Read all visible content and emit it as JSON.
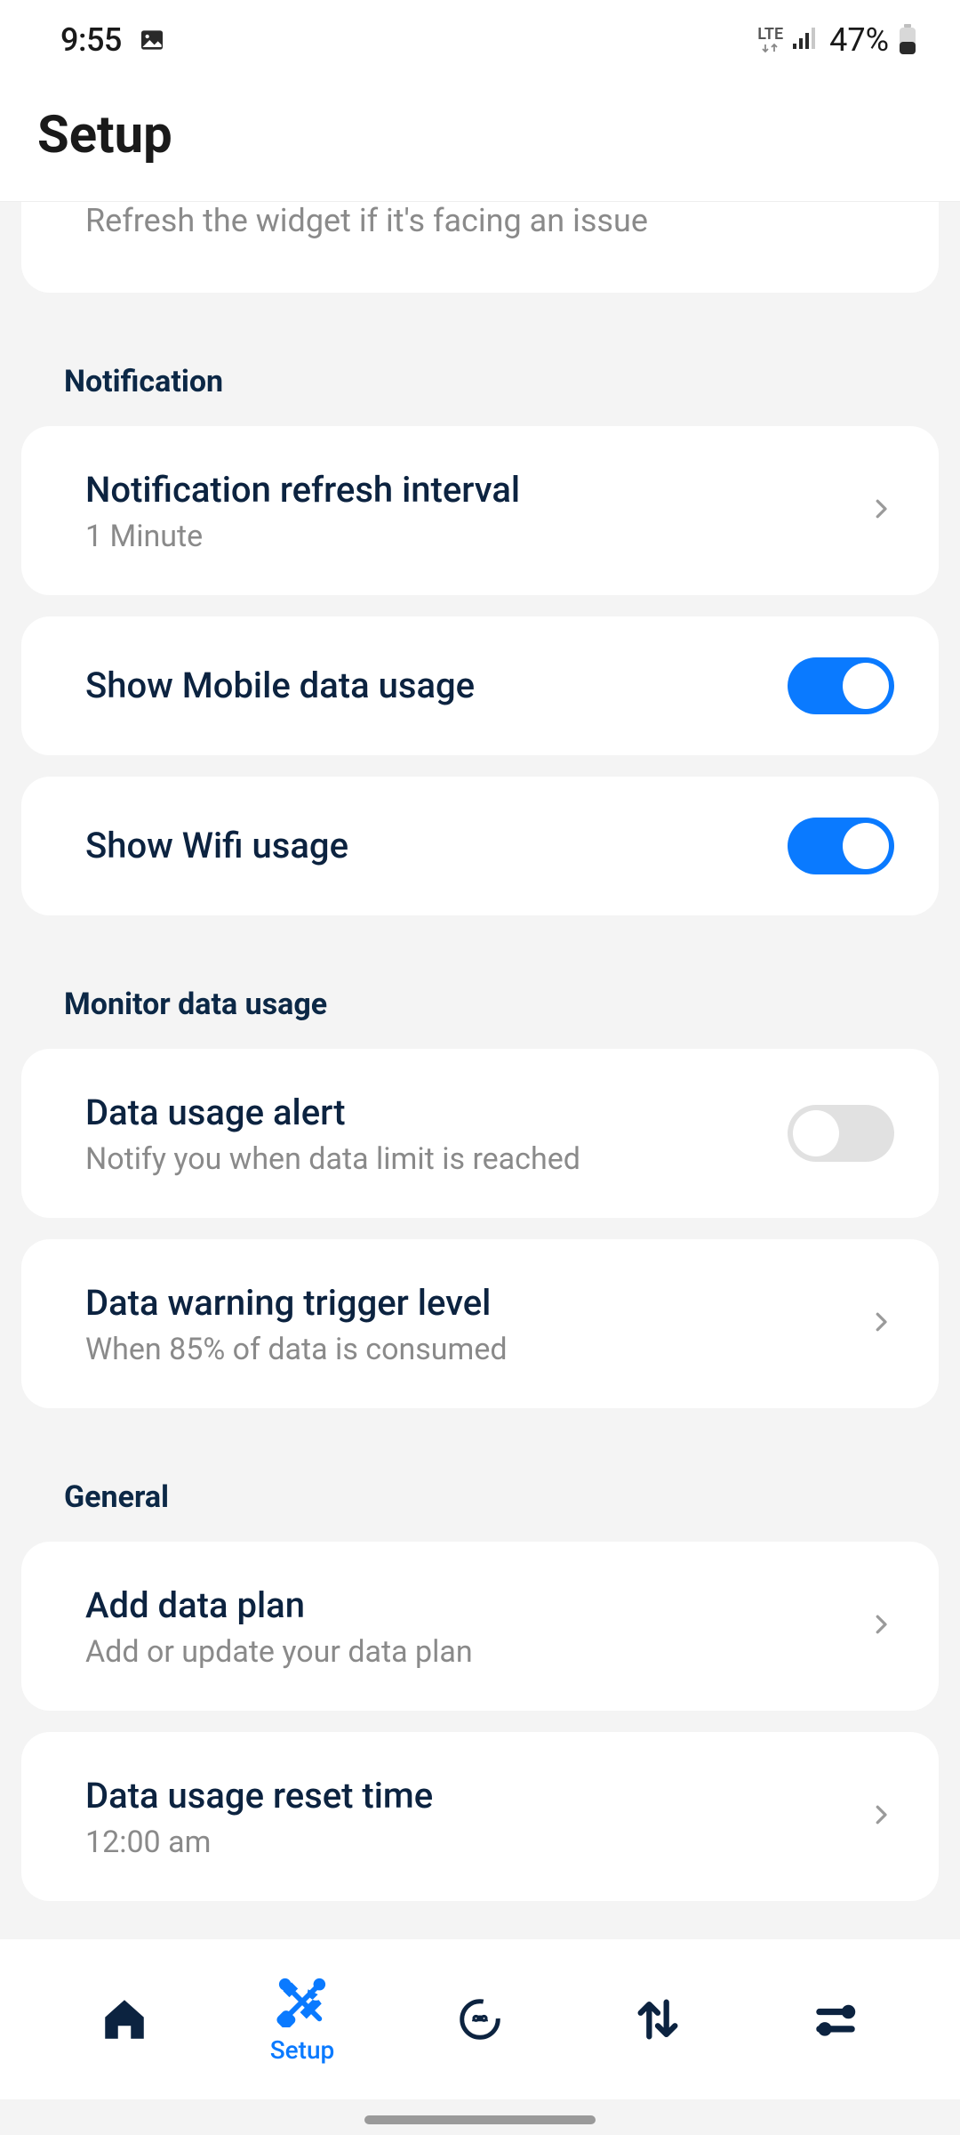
{
  "status": {
    "time": "9:55",
    "lte": "LTE",
    "battery": "47%"
  },
  "header": {
    "title": "Setup"
  },
  "partial": {
    "subtitle": "Refresh the widget if it's facing an issue"
  },
  "sections": {
    "notification": {
      "title": "Notification",
      "refresh_interval": {
        "title": "Notification refresh interval",
        "value": "1 Minute"
      },
      "show_mobile": {
        "title": "Show Mobile data usage",
        "on": true
      },
      "show_wifi": {
        "title": "Show Wifi usage",
        "on": true
      }
    },
    "monitor": {
      "title": "Monitor data usage",
      "alert": {
        "title": "Data usage alert",
        "subtitle": "Notify you when data limit is reached",
        "on": false
      },
      "trigger": {
        "title": "Data warning trigger level",
        "subtitle": "When 85% of data is consumed"
      }
    },
    "general": {
      "title": "General",
      "add_plan": {
        "title": "Add data plan",
        "subtitle": "Add or update your data plan"
      },
      "reset_time": {
        "title": "Data usage reset time",
        "value": "12:00 am"
      }
    }
  },
  "nav": {
    "setup_label": "Setup",
    "active": "setup"
  },
  "colors": {
    "accent": "#0a7aff",
    "dark": "#0c2340"
  }
}
